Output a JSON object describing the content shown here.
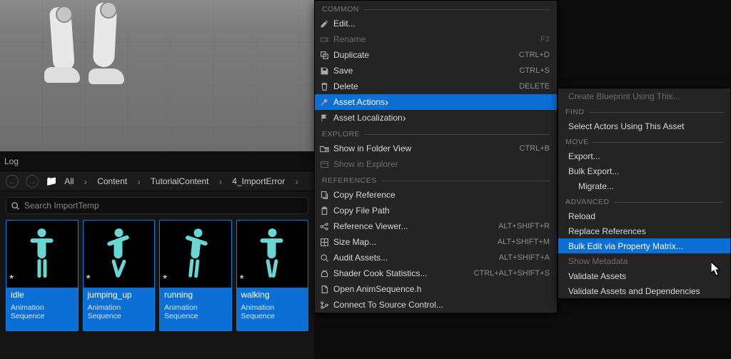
{
  "log_title": "Log",
  "breadcrumbs": {
    "all": "All",
    "items": [
      "Content",
      "TutorialContent",
      "4_ImportError"
    ]
  },
  "search": {
    "placeholder": "Search ImportTemp"
  },
  "assets": [
    {
      "name": "idle",
      "type": "Animation Sequence",
      "pose": "idle"
    },
    {
      "name": "jumping_up",
      "type": "Animation Sequence",
      "pose": "jump"
    },
    {
      "name": "running",
      "type": "Animation Sequence",
      "pose": "run"
    },
    {
      "name": "walking",
      "type": "Animation Sequence",
      "pose": "walk"
    }
  ],
  "menu": {
    "sections": {
      "common": "COMMON",
      "explore": "EXPLORE",
      "references": "REFERENCES"
    },
    "items": {
      "edit": {
        "label": "Edit...",
        "shortcut": ""
      },
      "rename": {
        "label": "Rename",
        "shortcut": "F2"
      },
      "duplicate": {
        "label": "Duplicate",
        "shortcut": "CTRL+D"
      },
      "save": {
        "label": "Save",
        "shortcut": "CTRL+S"
      },
      "delete": {
        "label": "Delete",
        "shortcut": "DELETE"
      },
      "asset_actions": {
        "label": "Asset Actions"
      },
      "asset_loc": {
        "label": "Asset Localization"
      },
      "show_folder": {
        "label": "Show in Folder View",
        "shortcut": "CTRL+B"
      },
      "show_explorer": {
        "label": "Show in Explorer"
      },
      "copy_ref": {
        "label": "Copy Reference"
      },
      "copy_path": {
        "label": "Copy File Path"
      },
      "ref_viewer": {
        "label": "Reference Viewer...",
        "shortcut": "ALT+SHIFT+R"
      },
      "size_map": {
        "label": "Size Map...",
        "shortcut": "ALT+SHIFT+M"
      },
      "audit": {
        "label": "Audit Assets...",
        "shortcut": "ALT+SHIFT+A"
      },
      "shader_cook": {
        "label": "Shader Cook Statistics...",
        "shortcut": "CTRL+ALT+SHIFT+S"
      },
      "open_h": {
        "label": "Open AnimSequence.h"
      },
      "source_ctrl": {
        "label": "Connect To Source Control..."
      }
    }
  },
  "submenu": {
    "sections": {
      "find": "FIND",
      "move": "MOVE",
      "advanced": "ADVANCED"
    },
    "items": {
      "create_bp": {
        "label": "Create Blueprint Using This..."
      },
      "select_actors": {
        "label": "Select Actors Using This Asset"
      },
      "export": {
        "label": "Export..."
      },
      "bulk_export": {
        "label": "Bulk Export..."
      },
      "migrate": {
        "label": "Migrate..."
      },
      "reload": {
        "label": "Reload"
      },
      "replace_ref": {
        "label": "Replace References"
      },
      "bulk_edit": {
        "label": "Bulk Edit via Property Matrix..."
      },
      "show_meta": {
        "label": "Show Metadata"
      },
      "validate": {
        "label": "Validate Assets"
      },
      "validate_dep": {
        "label": "Validate Assets and Dependencies"
      }
    }
  }
}
